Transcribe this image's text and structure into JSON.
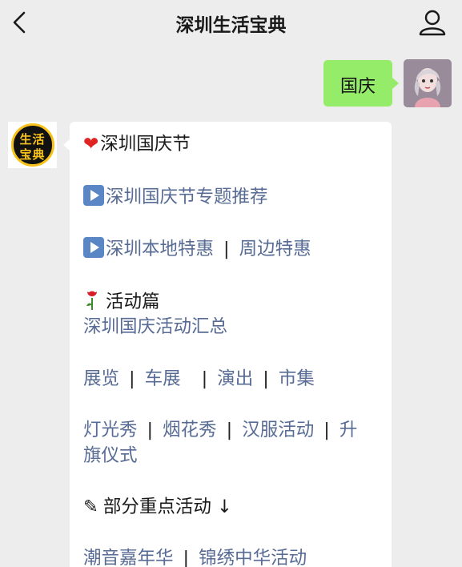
{
  "header": {
    "title": "深圳生活宝典",
    "back_icon": "chevron-left-icon",
    "profile_icon": "person-icon"
  },
  "user_message": {
    "text": "国庆",
    "bubble_color": "#95ec69"
  },
  "bot": {
    "logo_line1": "生活",
    "logo_line2": "宝典",
    "logo_colors": {
      "background": "#111111",
      "text": "#f7c21a"
    }
  },
  "reply": {
    "heading1": "深圳国庆节",
    "link_topic": "深圳国庆节专题推荐",
    "link_local_deals": "深圳本地特惠",
    "link_nearby_deals": "周边特惠",
    "heading_activities": "活动篇",
    "link_summary": "深圳国庆活动汇总",
    "link_exhibition": "展览",
    "link_car_show": "车展",
    "link_performance": "演出",
    "link_market": "市集",
    "link_light_show": "灯光秀",
    "link_fireworks": "烟花秀",
    "link_hanfu": "汉服活动",
    "link_flag_part1": "升",
    "link_flag_part2": "旗仪式",
    "heading_highlights": "部分重点活动 ↓",
    "link_carnival": "潮音嘉年华",
    "link_brocade": "锦绣中华活动",
    "separator": "|",
    "link_color": "#576b95"
  }
}
